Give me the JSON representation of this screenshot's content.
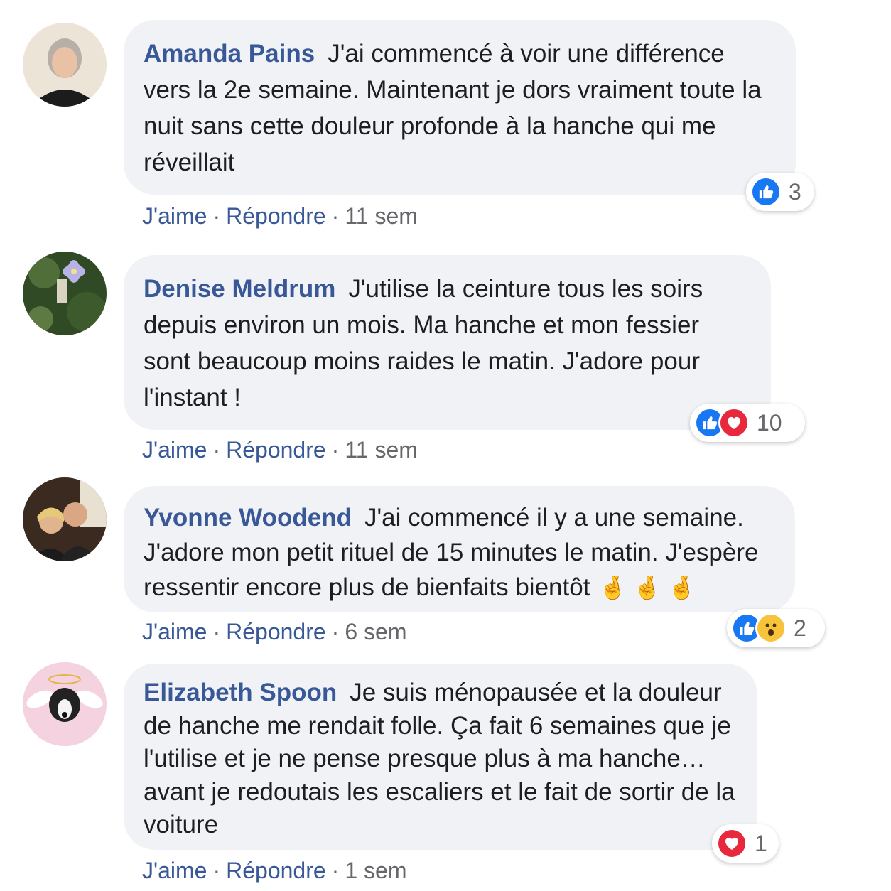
{
  "colors": {
    "name": "#385898",
    "bubble": "#f0f2f5",
    "like": "#1877f2",
    "love": "#e8283c",
    "wow": "#f7c33a"
  },
  "comments": [
    {
      "name": "Amanda Pains",
      "text": "J'ai commencé à voir une différence vers la 2e semaine. Maintenant je dors vraiment toute la nuit sans cette douleur profonde à la hanche qui me réveillait",
      "like": "J'aime",
      "reply": "Répondre",
      "time": "11 sem",
      "reaction_count": "3",
      "reactions": [
        "like-icon"
      ]
    },
    {
      "name": "Denise Meldrum",
      "text": "J'utilise la ceinture tous les soirs depuis environ un mois. Ma hanche et mon fessier sont beaucoup moins raides le matin. J'adore pour l'instant !",
      "like": "J'aime",
      "reply": "Répondre",
      "time": "11 sem",
      "reaction_count": "10",
      "reactions": [
        "like-icon",
        "heart-icon"
      ]
    },
    {
      "name": "Yvonne Woodend",
      "text": "J'ai commencé il y a une semaine. J'adore mon petit rituel de 15 minutes le matin. J'espère ressentir encore plus de bienfaits bientôt",
      "emojis": "🤞 🤞 🤞",
      "like": "J'aime",
      "reply": "Répondre",
      "time": "6 sem",
      "reaction_count": "2",
      "reactions": [
        "like-icon",
        "wow-icon"
      ]
    },
    {
      "name": "Elizabeth Spoon",
      "text": "Je suis ménopausée et la douleur de hanche me rendait folle. Ça fait 6 semaines que je l'utilise et je ne pense presque plus à ma hanche… avant je redoutais les escaliers et le fait de sortir de la voiture",
      "like": "J'aime",
      "reply": "Répondre",
      "time": "1 sem",
      "reaction_count": "1",
      "reactions": [
        "heart-icon"
      ]
    }
  ]
}
